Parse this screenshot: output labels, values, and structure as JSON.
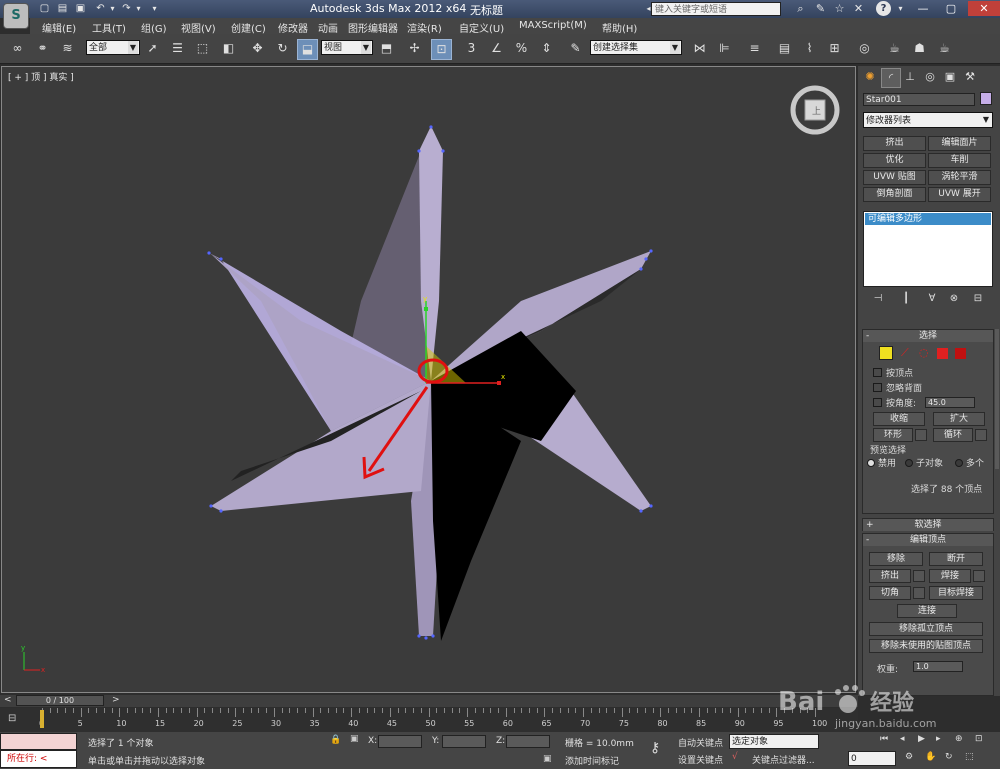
{
  "title_bar": {
    "app_title": "Autodesk 3ds Max  2012 x64",
    "document_title": "无标题",
    "search_placeholder": "键入关键字或短语"
  },
  "menu": [
    "编辑(E)",
    "工具(T)",
    "组(G)",
    "视图(V)",
    "创建(C)",
    "修改器",
    "动画",
    "图形编辑器",
    "渲染(R)",
    "自定义(U)",
    "MAXScript(M)",
    "帮助(H)"
  ],
  "toolbar": {
    "selection_filter": "全部",
    "reference_coord": "视图",
    "named_selection": "创建选择集",
    "snap_angle_label": "3",
    "percent_label": "%"
  },
  "viewport": {
    "label": "[ + ] 顶 ] 真实 ]",
    "axis_x": "x",
    "axis_y": "y",
    "gizmo_x": "x",
    "gizmo_y": "y"
  },
  "command_panel": {
    "object_name": "Star001",
    "object_color": "#c6aee8",
    "modifier_list": "修改器列表",
    "modifier_buttons": [
      "挤出",
      "编辑面片",
      "优化",
      "车削",
      "UVW 贴图",
      "涡轮平滑",
      "倒角剖面",
      "UVW 展开"
    ],
    "stack_item": "可编辑多边形",
    "selection": {
      "title": "选择",
      "by_vertex": "按顶点",
      "ignore_backfacing": "忽略背面",
      "by_angle": "按角度:",
      "angle_value": "45.0",
      "shrink": "收缩",
      "grow": "扩大",
      "ring": "环形",
      "loop": "循环",
      "preview_title": "预览选择",
      "preview_off": "禁用",
      "preview_subobj": "子对象",
      "preview_multi": "多个",
      "status": "选择了 88 个顶点"
    },
    "soft_selection": "软选择",
    "edit_vertices": {
      "title": "编辑顶点",
      "remove": "移除",
      "break": "断开",
      "extrude": "挤出",
      "weld": "焊接",
      "chamfer": "切角",
      "target_weld": "目标焊接",
      "connect": "连接",
      "remove_isolated": "移除孤立顶点",
      "remove_unused_map": "移除未使用的贴图顶点",
      "weight_label": "权重:",
      "weight_value": "1.0"
    }
  },
  "timeline": {
    "frame_display": "0 / 100",
    "ticks": [
      "0",
      "5",
      "10",
      "15",
      "20",
      "25",
      "30",
      "35",
      "40",
      "45",
      "50",
      "55",
      "60",
      "65",
      "70",
      "75",
      "80",
      "85",
      "90",
      "95",
      "100"
    ]
  },
  "status_bar": {
    "listener_label": "所在行:",
    "selection_status": "选择了 1 个对象",
    "prompt": "单击或单击并拖动以选择对象",
    "x_label": "X:",
    "y_label": "Y:",
    "z_label": "Z:",
    "grid": "栅格 = 10.0mm",
    "add_time_tag": "添加时间标记",
    "auto_key": "自动关键点",
    "set_key": "设置关键点",
    "selected_object": "选定对象",
    "key_filters": "关键点过滤器...",
    "frame_value": "0"
  },
  "watermark": {
    "brand": "Bai",
    "brand_cn": "经验",
    "url": "jingyan.baidu.com"
  }
}
